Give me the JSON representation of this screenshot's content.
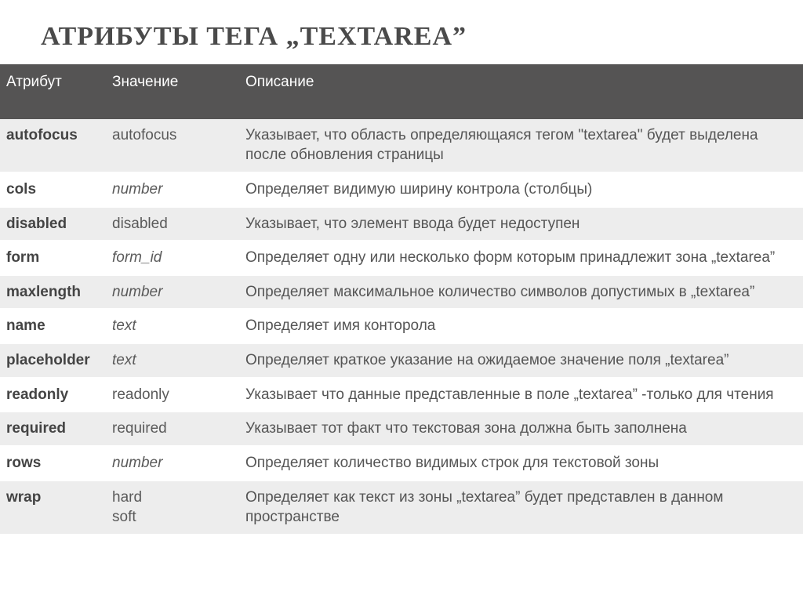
{
  "title": "АТРИБУТЫ ТЕГА  „TEXTAREA”",
  "headers": {
    "attr": "Атрибут",
    "val": "Значение",
    "desc": "Описание"
  },
  "rows": [
    {
      "attr": "autofocus",
      "val": "autofocus",
      "val_italic": false,
      "desc": "Указывает, что область определяющаяся  тегом \"textarea\" будет выделена после обновления страницы"
    },
    {
      "attr": "cols",
      "val": "number",
      "val_italic": true,
      "desc": "Определяет видимую ширину контрола (столбцы)"
    },
    {
      "attr": "disabled",
      "val": "disabled",
      "val_italic": false,
      "desc": "Указывает, что элемент ввода будет недоступен"
    },
    {
      "attr": "form",
      "val": "form_id",
      "val_italic": true,
      "desc": "Определяет одну или несколько форм которым принадлежит  зона  „textarea”"
    },
    {
      "attr": "maxlength",
      "val": "number",
      "val_italic": true,
      "desc": "Определяет максимальное количество символов допустимых в „textarea”"
    },
    {
      "attr": "name",
      "val": "text",
      "val_italic": true,
      "desc": "Определяет имя конторола"
    },
    {
      "attr": "placeholder",
      "val": "text",
      "val_italic": true,
      "desc": "Определяет  краткое указание на ожидаемое значение поля „textarea”"
    },
    {
      "attr": "readonly",
      "val": "readonly",
      "val_italic": false,
      "desc": "Указывает что данные представленные в поле „textarea”  -только для чтения"
    },
    {
      "attr": "required",
      "val": "required",
      "val_italic": false,
      "desc": "Указывает тот факт что текстовая зона должна быть заполнена"
    },
    {
      "attr": "rows",
      "val": "number",
      "val_italic": true,
      "desc": "Определяет количество видимых строк для текстовой зоны"
    },
    {
      "attr": "wrap",
      "val_lines": [
        "hard",
        "soft"
      ],
      "val_italic": false,
      "desc": "Определяет как текст из зоны „textarea” будет представлен в данном пространстве"
    }
  ]
}
